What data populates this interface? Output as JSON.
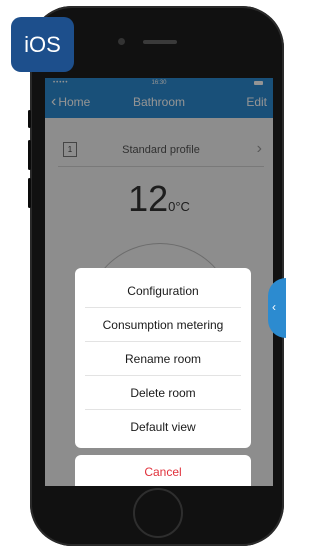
{
  "badge": {
    "label": "iOS"
  },
  "status_bar": {
    "carrier": "•••••  ",
    "time": "16:30"
  },
  "nav": {
    "back_label": "Home",
    "title": "Bathroom",
    "edit_label": "Edit"
  },
  "profile": {
    "number": "1",
    "label": "Standard profile"
  },
  "temperature": {
    "value": "12",
    "unit": "0°C"
  },
  "action_sheet": {
    "items": [
      "Configuration",
      "Consumption metering",
      "Rename room",
      "Delete room",
      "Default view"
    ],
    "cancel_label": "Cancel"
  },
  "colors": {
    "accent": "#2c8bd0",
    "badge": "#1d4f8c",
    "cancel": "#e0323c"
  }
}
